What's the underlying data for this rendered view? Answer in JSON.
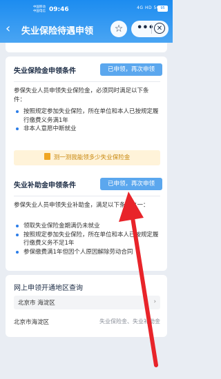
{
  "status_bar": {
    "carrier_1": "中国移动",
    "carrier_2": "中国电信",
    "time": "09:46",
    "network": "4G HD",
    "signal": "5G",
    "battery": "95"
  },
  "nav": {
    "back_icon": "chevron-left-icon",
    "title": "失业保险待遇申领",
    "favorite_icon": "star-icon",
    "more_icon": "more-icon",
    "close_icon": "close-icon"
  },
  "benefit_card": {
    "title": "失业保险金申领条件",
    "apply_label": "已申领，再次申领",
    "intro": "参保失业人员申领失业保险金，必须同时满足以下条件：",
    "bullets": [
      "按照规定参加失业保险，所在单位和本人已按规定履行缴费义务满1年",
      "非本人意愿中断就业"
    ],
    "calc_label": "测一测我能领多少失业保险金"
  },
  "subsidy_card": {
    "title": "失业补助金申领条件",
    "apply_label": "已申领，再次申领",
    "intro": "参保失业人员申领失业补助金，满足以下条件之一：",
    "bullets": [
      "领取失业保险金期满仍未就业",
      "按照规定参加失业保险，所在单位和本人已按规定履行缴费义务不足1年",
      "参保缴费满1年但因个人原因解除劳动合同"
    ]
  },
  "region_card": {
    "title": "网上申领开通地区查询",
    "selected_region": "北京市 海淀区",
    "result_city": "北京市海淀区",
    "result_types": "失业保险金、失业补助金"
  },
  "colors": {
    "header": "#1c8cf0",
    "button": "#5ba7ee",
    "arrow": "#e8242a"
  }
}
